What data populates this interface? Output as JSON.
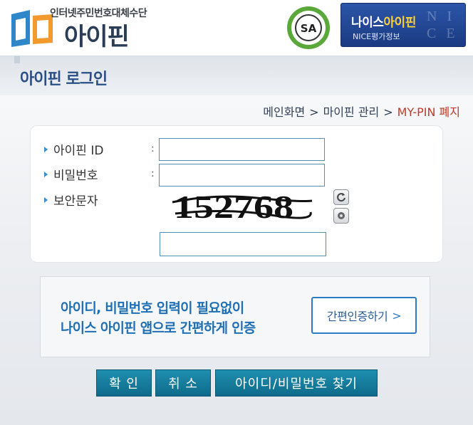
{
  "header": {
    "logo_tagline": "인터넷주민번호대체수단",
    "logo_name": "아이핀",
    "sa_badge_text": "SA",
    "nice_title_prefix": "나이스",
    "nice_title_accent": "아이핀",
    "nice_sub": "NICE평가정보"
  },
  "page_title": "아이핀 로그인",
  "breadcrumb": {
    "items": [
      "메인화면",
      "마이핀 관리",
      "MY-PIN 폐지"
    ],
    "separator": ">"
  },
  "form": {
    "id_label": "아이핀 ID",
    "password_label": "비밀번호",
    "captcha_label": "보안문자",
    "colon": ":",
    "id_value": "",
    "password_value": "",
    "captcha_input_value": "",
    "captcha_text": "152768"
  },
  "info": {
    "line1": "아이디, 비밀번호 입력이 필요없이",
    "line2": "나이스 아이핀 앱으로 간편하게 인증",
    "button_label": "간편인증하기",
    "button_chevron": ">"
  },
  "buttons": {
    "confirm": "확 인",
    "cancel": "취 소",
    "find": "아이디/비밀번호 찾기"
  },
  "colors": {
    "accent_blue": "#2a4f86",
    "button_teal": "#1a7fa0",
    "breadcrumb_current": "#c0392b",
    "info_blue": "#1f6fb5"
  },
  "icons": [
    "ipin-logo-icon",
    "sa-certification-icon",
    "refresh-icon",
    "audio-icon",
    "chevron-right-icon"
  ]
}
